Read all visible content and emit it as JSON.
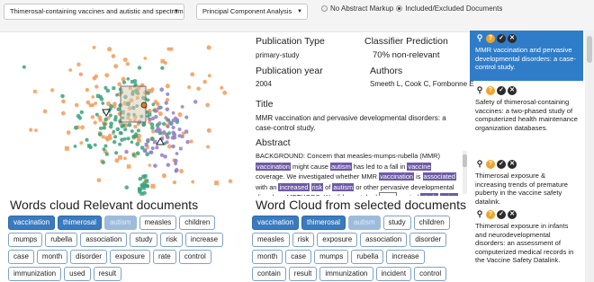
{
  "topbar": {
    "dataset_select": "Thimerosal-containing vaccines and autistic and spectrum",
    "method_select": "Principal Component Analysis",
    "radio_no_markup": "No Abstract Markup",
    "radio_included": "Included/Excluded Documents"
  },
  "colors": {
    "orange": "#f39a58",
    "green": "#3aa37e",
    "purple": "#8f7fc6",
    "active": "#3a7bbf"
  },
  "left_cloud": {
    "title": "Words cloud Relevant documents",
    "words": [
      "vaccination",
      "thimerosal",
      "autism",
      "measles",
      "children",
      "mumps",
      "rubella",
      "association",
      "study",
      "risk",
      "increase",
      "case",
      "month",
      "disorder",
      "exposure",
      "rate",
      "control",
      "immunization",
      "used",
      "result"
    ]
  },
  "detail": {
    "pub_type_label": "Publication Type",
    "pub_type_value": "primary-study",
    "classifier_label": "Classifier Prediction",
    "classifier_value": "70% non-relevant",
    "pub_year_label": "Publication year",
    "pub_year_value": "2004",
    "authors_label": "Authors",
    "authors_value": "Smeeth L, Cook C, Fombonne E",
    "title_label": "Title",
    "title_value": "MMR vaccination and pervasive developmental disorders: a case-control study.",
    "abstract_label": "Abstract",
    "abstract_segments": [
      [
        "BACKGROUND: Concern that measles-mumps-rubella (MMR) ",
        ""
      ],
      [
        "vaccination",
        "hl"
      ],
      [
        " might cause ",
        ""
      ],
      [
        "autism",
        "hl"
      ],
      [
        " has led to a fall in ",
        ""
      ],
      [
        "vaccine",
        "hl"
      ],
      [
        " coverage. We investigated whether MMR ",
        ""
      ],
      [
        "vaccination",
        "hl"
      ],
      [
        " is ",
        ""
      ],
      [
        "associated",
        "hl"
      ],
      [
        " with an ",
        ""
      ],
      [
        "increased",
        "hl"
      ],
      [
        " ",
        ""
      ],
      [
        "risk",
        "hl"
      ],
      [
        " of ",
        ""
      ],
      [
        "autism",
        "hl"
      ],
      [
        " or other pervasive developmental disorders. METHODS: We did a matched ",
        ""
      ],
      [
        "case",
        "box"
      ],
      [
        "-control ",
        ""
      ],
      [
        "study",
        "hl"
      ],
      [
        " ",
        ""
      ],
      [
        "using",
        "hl"
      ],
      [
        " the UK General",
        ""
      ]
    ]
  },
  "right_cloud": {
    "title": "Word Cloud from selected documents",
    "words": [
      "vaccination",
      "thimerosal",
      "autism",
      "study",
      "children",
      "measles",
      "risk",
      "exposure",
      "association",
      "disorder",
      "month",
      "case",
      "mumps",
      "rubella",
      "increase",
      "contain",
      "result",
      "immunization",
      "incident",
      "control"
    ]
  },
  "documents": [
    "MMR vaccination and pervasive developmental disorders: a case-control study.",
    "Safety of thimerosal-containing vaccines: a two-phased study of computerized health maintenance organization databases.",
    "Thimerosal exposure & increasing trends of premature puberty in the vaccine safety datalink.",
    "Thimerosal exposure in infants and neurodevelopmental disorders: an assessment of computerized medical records in the Vaccine Safety Datalink."
  ],
  "doc_icons": [
    "zoom-icon",
    "question-icon",
    "check-icon",
    "cross-icon"
  ]
}
